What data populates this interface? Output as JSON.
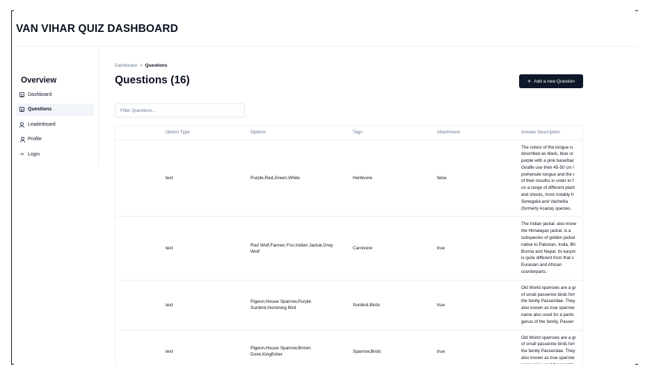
{
  "app": {
    "title": "VAN VIHAR QUIZ DASHBOARD"
  },
  "sidebar": {
    "heading": "Overview",
    "items": [
      {
        "label": "Dashboard",
        "icon": "dashboard-grid-icon",
        "active": false
      },
      {
        "label": "Questions",
        "icon": "questions-grid-icon",
        "active": true
      },
      {
        "label": "Leaderboard",
        "icon": "users-icon",
        "active": false
      },
      {
        "label": "Profile",
        "icon": "user-icon",
        "active": false
      },
      {
        "label": "Login",
        "icon": "login-arrow-icon",
        "active": false
      }
    ]
  },
  "breadcrumb": {
    "root": "Dashboard",
    "separator": ">",
    "current": "Questions"
  },
  "page": {
    "title": "Questions (16)"
  },
  "actions": {
    "add_question_label": "Add a new Question"
  },
  "filter": {
    "placeholder": "Filter Questions...",
    "value": ""
  },
  "table": {
    "columns": [
      "Option Type",
      "Options",
      "Tags",
      "Attachment",
      "Answer Description"
    ],
    "rows": [
      {
        "option_type": "text",
        "options": "Purple,Red,Green,White",
        "tags": "Herbivore",
        "attachment": "false",
        "answer_description": "The colour of the tongue is\ndescribed as black, blue or\npurple with a pink base/bac\nGiraffe use their 45-50 cm l\nprehensile tongue and the r\nof their mouths in order to f\non a range of different plant\nand shoots, most notably fr\nSenegalia and Vachellia\n(formerly Acacia) species."
      },
      {
        "option_type": "text",
        "options": "Red Wolf,Fannec Fox,Indian Jackal,Grey Wolf",
        "tags": "Carnivore",
        "attachment": "true",
        "answer_description": "The Indian jackal, also know\nthe Himalayan jackal, is a\nsubspecies of golden jackal\nnative to Pakistan, India, Bh\nBurma and Nepal. Its karyot\nis quite different from that c\nEurasian and African\ncounterparts."
      },
      {
        "option_type": "text",
        "options": "Pigeon,House Sparrow,Purple Sunbird,Humming Bird",
        "tags": "Sunbird,Birds",
        "attachment": "true",
        "answer_description": "Old World sparrows are a gr\nof small passerine birds forr\nthe family Passeridae. They\nalso known as true sparrow\nname also used for a partic\ngenus of the family, Passer"
      },
      {
        "option_type": "text",
        "options": "Pigeon,House Sparrow,Brown Dove,Kingfisher",
        "tags": "Sparrow,Birds",
        "attachment": "true",
        "answer_description": "Old World sparrows are a gr\nof small passerine birds forr\nthe family Passeridae. They\nalso known as true sparrow\nname also used for a partic"
      }
    ]
  }
}
